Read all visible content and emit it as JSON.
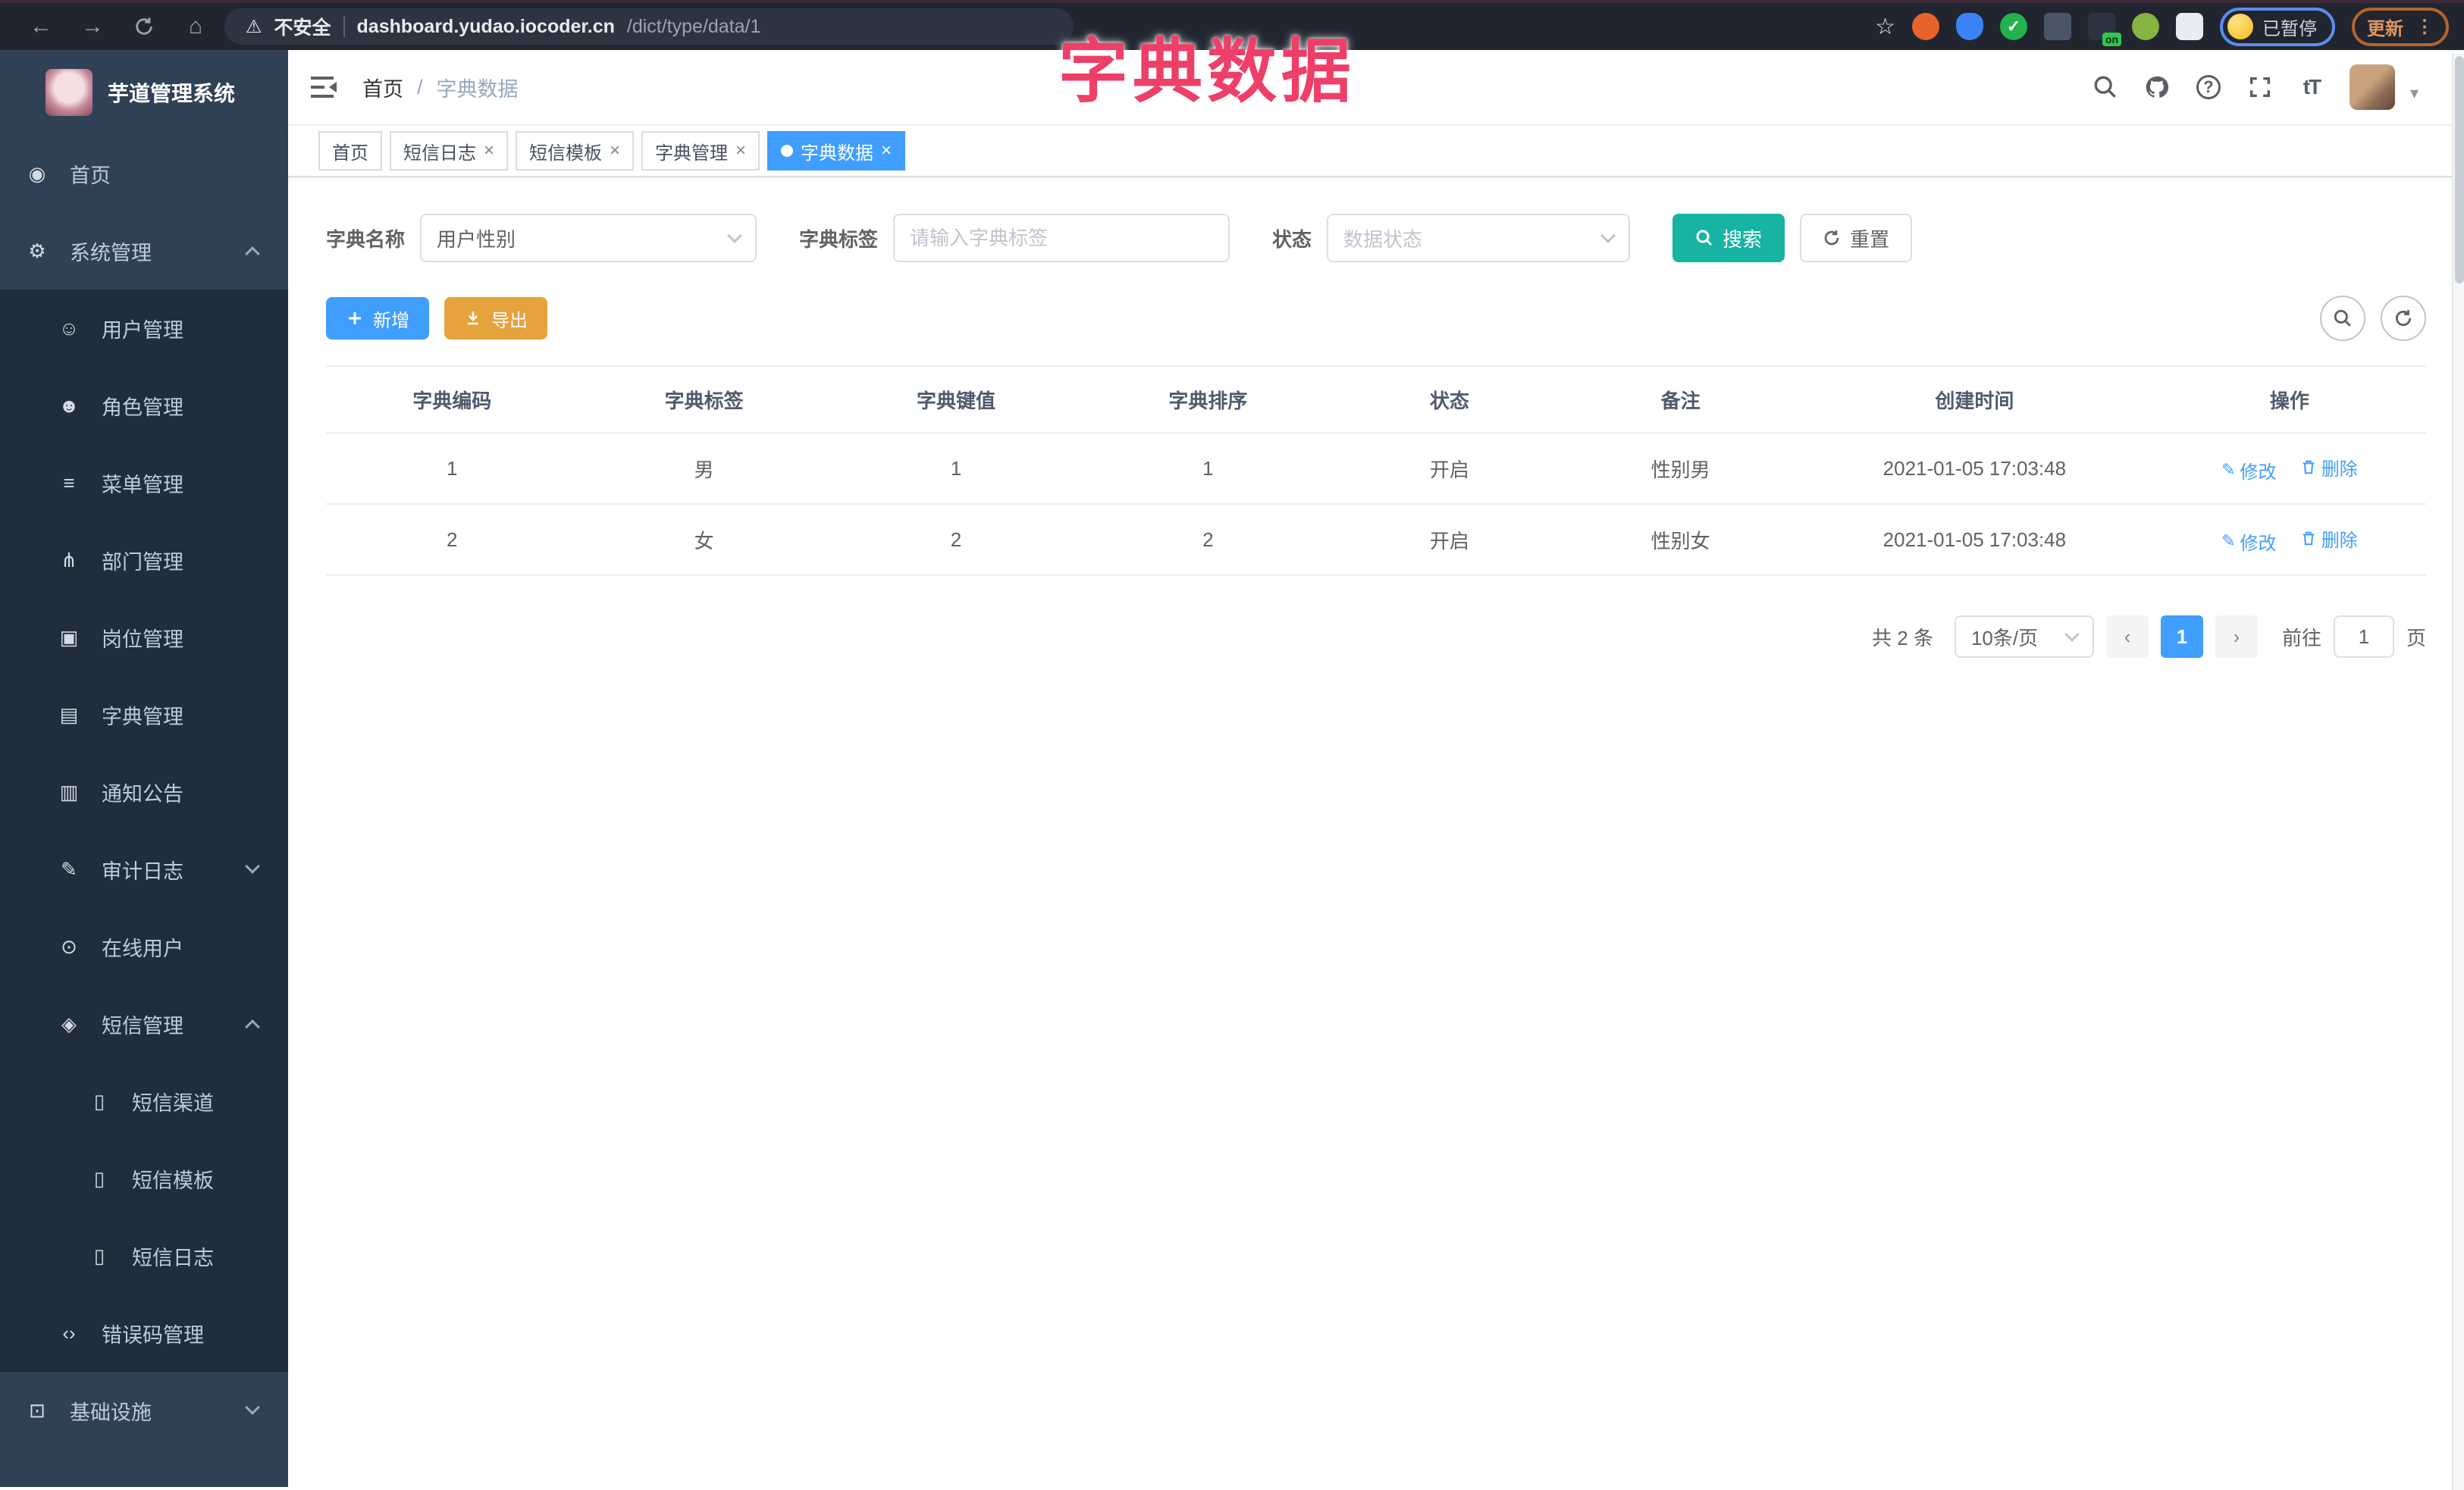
{
  "colors": {
    "accent_blue": "#409eff",
    "search_teal": "#17b3a3",
    "export_orange": "#e6a23c",
    "overlay_pink": "#ee3f68",
    "sidebar_bg": "#304156",
    "submenu_bg": "#1f2d3d",
    "chrome_bg": "#21252f"
  },
  "icons": {
    "back": "←",
    "forward": "→",
    "home": "⌂",
    "warning": "⚠",
    "star": "☆",
    "more_vertical": "⋮",
    "caret_down": "▾",
    "close": "×",
    "dot": "",
    "dashboard": "◉",
    "gear": "⚙",
    "user": "☺",
    "users": "☻",
    "menu": "≡",
    "dept": "⋔",
    "post": "▣",
    "dict": "▤",
    "notice": "▥",
    "audit": "✎",
    "online": "⊙",
    "sms": "◈",
    "phone": "▯",
    "code": "‹›",
    "infra": "⊡",
    "edit": "✎",
    "fontsize": "tT",
    "help": "?"
  },
  "browser": {
    "security_label": "不安全",
    "url_domain": "dashboard.yudao.iocoder.cn",
    "url_path": "/dict/type/data/1",
    "extension_badge": "on",
    "profile_status": "已暂停",
    "update_label": "更新"
  },
  "overlay_title": "字典数据",
  "sidebar": {
    "title": "芋道管理系统",
    "items": [
      {
        "label": "首页"
      },
      {
        "label": "系统管理"
      },
      {
        "label": "用户管理"
      },
      {
        "label": "角色管理"
      },
      {
        "label": "菜单管理"
      },
      {
        "label": "部门管理"
      },
      {
        "label": "岗位管理"
      },
      {
        "label": "字典管理"
      },
      {
        "label": "通知公告"
      },
      {
        "label": "审计日志"
      },
      {
        "label": "在线用户"
      },
      {
        "label": "短信管理"
      },
      {
        "label": "短信渠道"
      },
      {
        "label": "短信模板"
      },
      {
        "label": "短信日志"
      },
      {
        "label": "错误码管理"
      },
      {
        "label": "基础设施"
      }
    ]
  },
  "navbar": {
    "breadcrumb_home": "首页",
    "breadcrumb_separator": "/",
    "breadcrumb_current": "字典数据"
  },
  "tabs": [
    {
      "label": "首页"
    },
    {
      "label": "短信日志"
    },
    {
      "label": "短信模板"
    },
    {
      "label": "字典管理"
    },
    {
      "label": "字典数据"
    }
  ],
  "filters": {
    "dict_name_label": "字典名称",
    "dict_name_value": "用户性别",
    "dict_label_label": "字典标签",
    "dict_label_placeholder": "请输入字典标签",
    "status_label": "状态",
    "status_placeholder": "数据状态",
    "search_label": "搜索",
    "reset_label": "重置"
  },
  "toolbar": {
    "add_label": "新增",
    "export_label": "导出"
  },
  "table": {
    "headers": [
      "字典编码",
      "字典标签",
      "字典键值",
      "字典排序",
      "状态",
      "备注",
      "创建时间",
      "操作"
    ],
    "rows": [
      {
        "code": "1",
        "label": "男",
        "value": "1",
        "sort": "1",
        "status": "开启",
        "remark": "性别男",
        "created": "2021-01-05 17:03:48"
      },
      {
        "code": "2",
        "label": "女",
        "value": "2",
        "sort": "2",
        "status": "开启",
        "remark": "性别女",
        "created": "2021-01-05 17:03:48"
      }
    ],
    "edit_label": "修改",
    "delete_label": "删除"
  },
  "pagination": {
    "total": "共 2 条",
    "page_size": "10条/页",
    "current_page": "1",
    "prev": "‹",
    "next": "›",
    "goto_label": "前往",
    "goto_value": "1",
    "page_unit": "页"
  }
}
